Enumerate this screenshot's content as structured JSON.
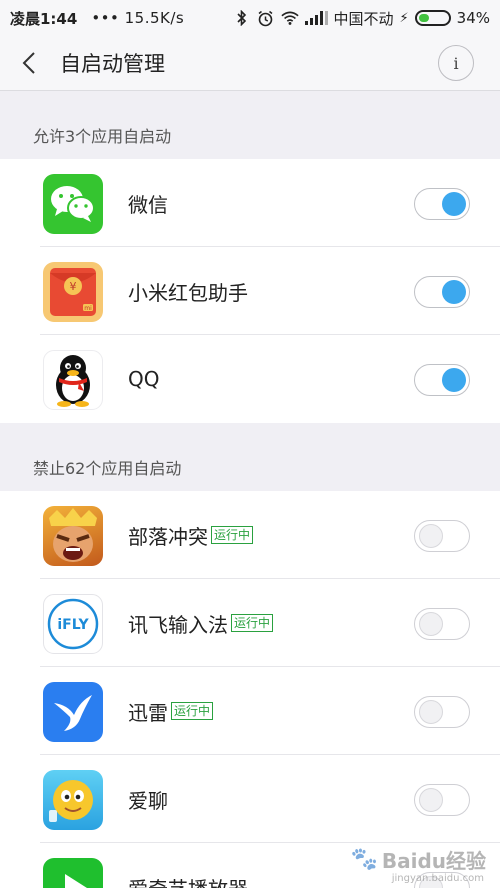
{
  "status_bar": {
    "time": "凌晨1:44",
    "dots": "•••",
    "speed": "15.5K/s",
    "carrier": "中国不动",
    "battery": "34%",
    "battery_level": 0.34,
    "icons": [
      "bluetooth-icon",
      "alarm-icon",
      "wifi-icon",
      "signal-icon",
      "charging-icon",
      "battery-icon"
    ]
  },
  "header": {
    "title": "自启动管理",
    "info_glyph": "i"
  },
  "allowed_section": {
    "title": "允许3个应用自启动",
    "apps": [
      {
        "name": "微信",
        "icon": "wechat-icon",
        "enabled": true
      },
      {
        "name": "小米红包助手",
        "icon": "mi-red-envelope-icon",
        "enabled": true,
        "icon_text": "¥",
        "icon_sub": "mi"
      },
      {
        "name": "QQ",
        "icon": "qq-penguin-icon",
        "enabled": true
      }
    ]
  },
  "blocked_section": {
    "title": "禁止62个应用自启动",
    "apps": [
      {
        "name": "部落冲突",
        "icon": "clash-of-clans-icon",
        "enabled": false,
        "status": "运行中"
      },
      {
        "name": "讯飞输入法",
        "icon": "ifly-icon",
        "enabled": false,
        "status": "运行中",
        "icon_text": "iFLY"
      },
      {
        "name": "迅雷",
        "icon": "xunlei-bird-icon",
        "enabled": false,
        "status": "运行中"
      },
      {
        "name": "爱聊",
        "icon": "ailiao-face-icon",
        "enabled": false
      },
      {
        "name": "爱奇艺播放器",
        "icon": "iqiyi-play-icon",
        "enabled": false
      }
    ]
  },
  "colors": {
    "accent": "#3ca8ee",
    "running": "#2aa13f",
    "background": "#f0eff4"
  },
  "watermark": {
    "text": "Baidu经验",
    "site": "jingyan.baidu.com"
  }
}
